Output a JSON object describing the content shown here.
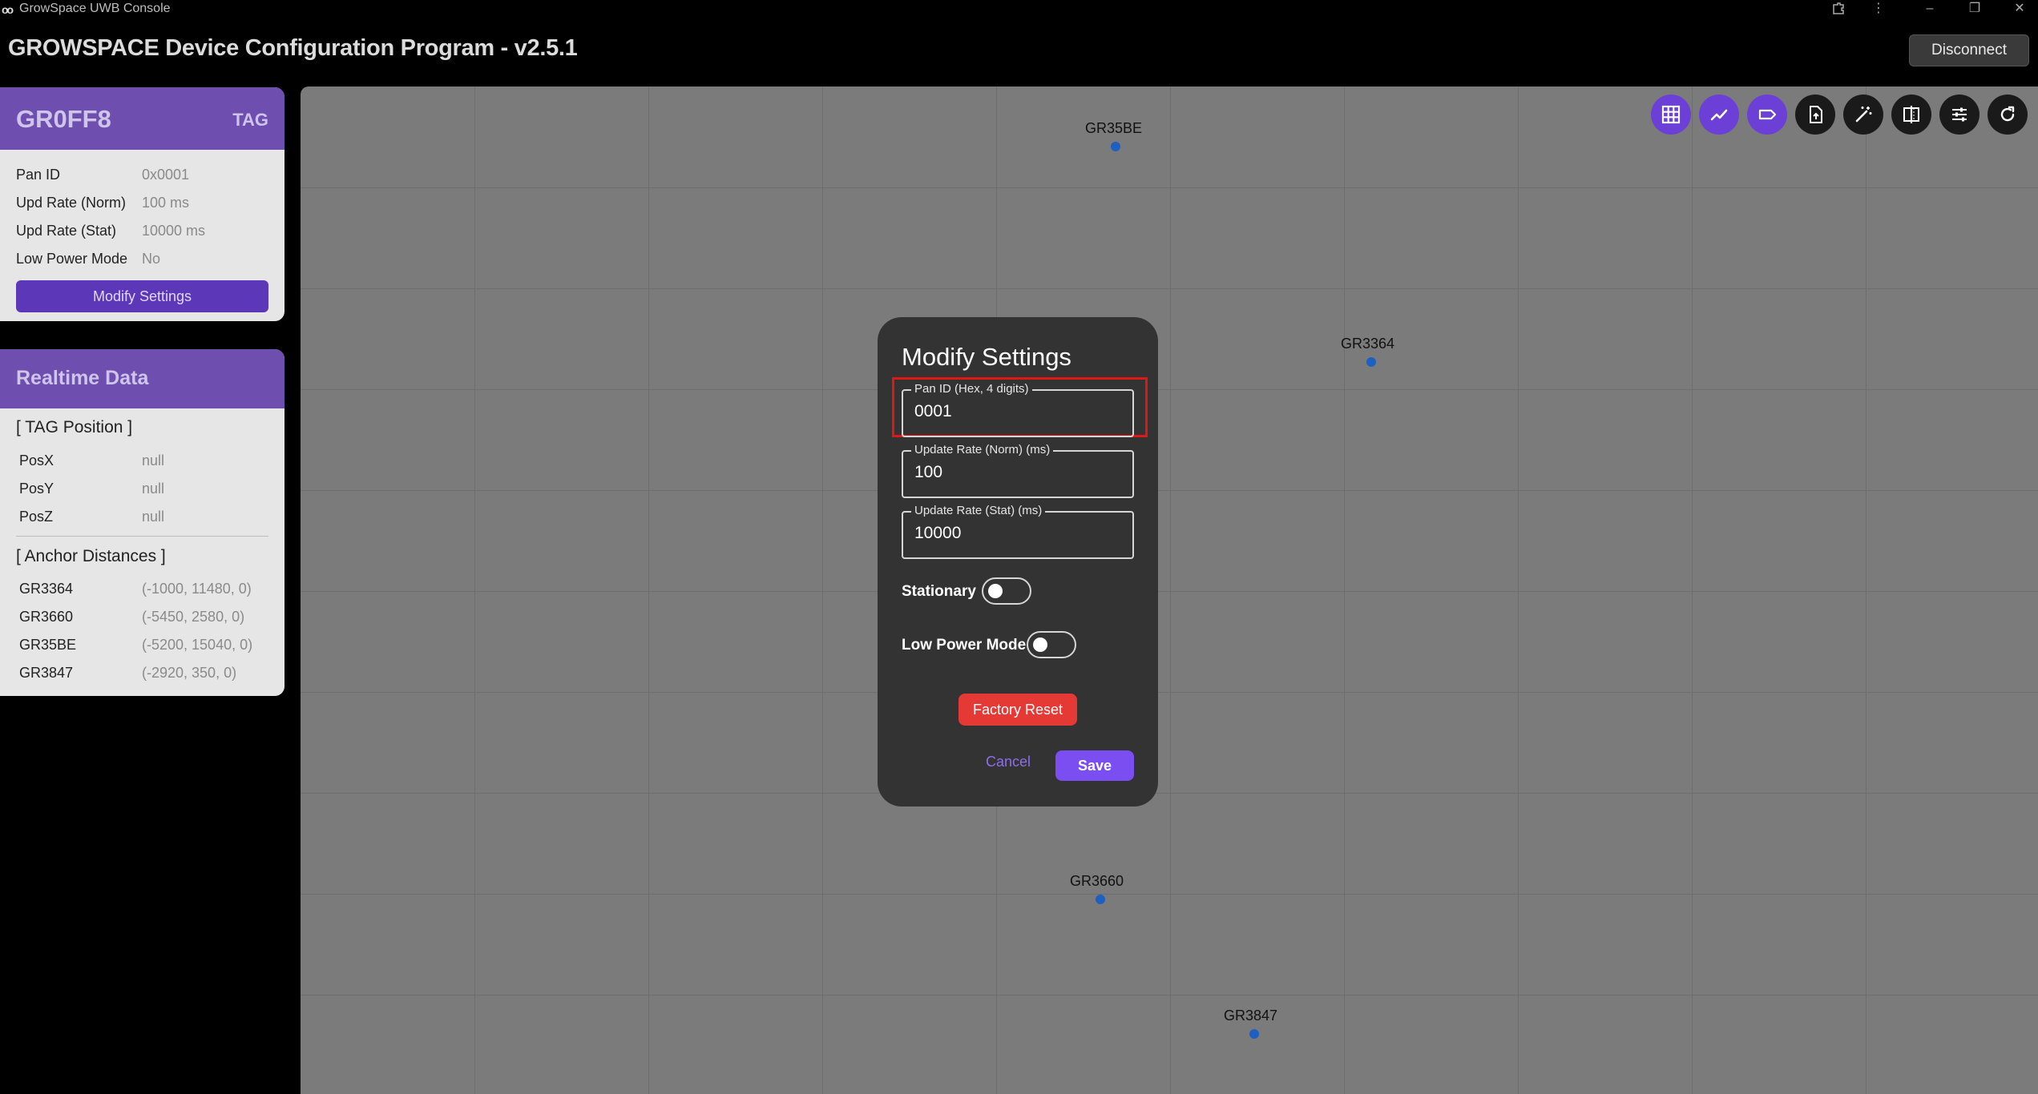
{
  "window": {
    "title": "GrowSpace UWB Console",
    "logo": "oo"
  },
  "header": {
    "title": "GROWSPACE Device Configuration Program - v2.5.1",
    "disconnect_label": "Disconnect"
  },
  "device_card": {
    "name": "GR0FF8",
    "type": "TAG",
    "rows": [
      {
        "label": "Pan ID",
        "value": "0x0001"
      },
      {
        "label": "Upd Rate (Norm)",
        "value": "100 ms"
      },
      {
        "label": "Upd Rate (Stat)",
        "value": "10000 ms"
      },
      {
        "label": "Low Power Mode",
        "value": "No"
      }
    ],
    "modify_label": "Modify Settings"
  },
  "realtime_card": {
    "title": "Realtime Data",
    "tag_section_title": "[ TAG Position ]",
    "position_rows": [
      {
        "label": "PosX",
        "value": "null"
      },
      {
        "label": "PosY",
        "value": "null"
      },
      {
        "label": "PosZ",
        "value": "null"
      }
    ],
    "anchor_section_title": "[ Anchor Distances ]",
    "anchor_rows": [
      {
        "label": "GR3364",
        "value": "(-1000, 11480, 0)"
      },
      {
        "label": "GR3660",
        "value": "(-5450, 2580, 0)"
      },
      {
        "label": "GR35BE",
        "value": "(-5200, 15040, 0)"
      },
      {
        "label": "GR3847",
        "value": "(-2920, 350, 0)"
      }
    ]
  },
  "map": {
    "anchors": [
      {
        "name": "GR35BE"
      },
      {
        "name": "GR3364"
      },
      {
        "name": "GR3660"
      },
      {
        "name": "GR3847"
      }
    ],
    "toolbar": [
      {
        "icon": "grid-icon",
        "active": true
      },
      {
        "icon": "chart-line-icon",
        "active": true
      },
      {
        "icon": "label-icon",
        "active": true
      },
      {
        "icon": "file-upload-icon",
        "active": false
      },
      {
        "icon": "magic-wand-icon",
        "active": false
      },
      {
        "icon": "compare-icon",
        "active": false
      },
      {
        "icon": "tune-icon",
        "active": false
      },
      {
        "icon": "refresh-icon",
        "active": false
      }
    ],
    "colors": {
      "background": "#7b7b7b",
      "anchor_dot": "#1f5fc2",
      "active_tool": "#6c3fd6"
    }
  },
  "modal": {
    "title": "Modify Settings",
    "pan_id": {
      "label": "Pan ID (Hex, 4 digits)",
      "value": "0001"
    },
    "rate_norm": {
      "label": "Update Rate (Norm) (ms)",
      "value": "100"
    },
    "rate_stat": {
      "label": "Update Rate (Stat) (ms)",
      "value": "10000"
    },
    "stationary": {
      "label": "Stationary",
      "on": false
    },
    "low_power": {
      "label": "Low Power Mode",
      "on": false
    },
    "factory_reset_label": "Factory Reset",
    "cancel_label": "Cancel",
    "save_label": "Save"
  }
}
